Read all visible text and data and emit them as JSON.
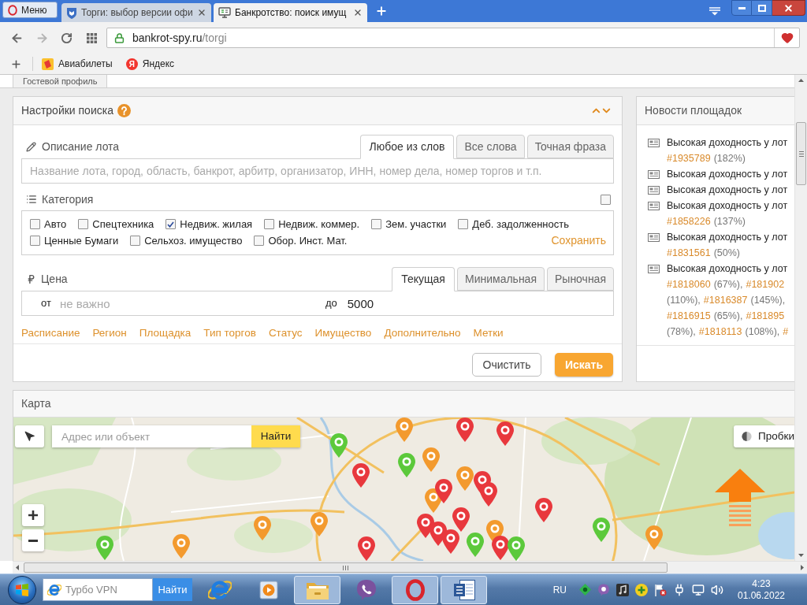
{
  "browser": {
    "menu_button": "Меню",
    "tabs": [
      {
        "title": "Торги: выбор версии офи",
        "selected": false,
        "kind": "emblem"
      },
      {
        "title": "Банкротство: поиск имущ",
        "selected": true,
        "kind": "monitor"
      }
    ],
    "address": {
      "host": "bankrot-spy.ru",
      "path": "/torgi"
    },
    "bookmarks": [
      {
        "kind": "tile",
        "label": "Авиабилеты"
      },
      {
        "kind": "letter",
        "logo": "Я",
        "label": "Яндекс"
      }
    ]
  },
  "profile_tab": {
    "label": "Гостевой профиль"
  },
  "search_panel": {
    "title": "Настройки поиска",
    "description": {
      "label": "Описание лота",
      "modes": [
        {
          "label": "Любое из слов",
          "selected": true
        },
        {
          "label": "Все слова",
          "selected": false
        },
        {
          "label": "Точная фраза",
          "selected": false
        }
      ],
      "placeholder": "Название лота, город, область, банкрот, арбитр, организатор, ИНН, номер дела, номер торгов и т.п."
    },
    "category": {
      "label": "Категория",
      "select_all": false,
      "options": [
        {
          "label": "Авто",
          "checked": false
        },
        {
          "label": "Спецтехника",
          "checked": false
        },
        {
          "label": "Недвиж. жилая",
          "checked": true
        },
        {
          "label": "Недвиж. коммер.",
          "checked": false
        },
        {
          "label": "Зем. участки",
          "checked": false
        },
        {
          "label": "Деб. задолженность",
          "checked": false
        },
        {
          "label": "Ценные Бумаги",
          "checked": false
        },
        {
          "label": "Сельхоз. имущество",
          "checked": false
        },
        {
          "label": "Обор. Инст. Мат.",
          "checked": false
        }
      ],
      "save_link": "Сохранить"
    },
    "price": {
      "label": "Цена",
      "modes": [
        {
          "label": "Текущая",
          "selected": true
        },
        {
          "label": "Минимальная",
          "selected": false
        },
        {
          "label": "Рыночная",
          "selected": false
        }
      ],
      "from_label": "от",
      "from_placeholder": "не важно",
      "to_label": "до",
      "to_value": "5000"
    },
    "filter_links": [
      "Расписание",
      "Регион",
      "Площадка",
      "Тип торгов",
      "Статус",
      "Имущество",
      "Дополнительно",
      "Метки"
    ],
    "clear_button": "Очистить",
    "search_button": "Искать"
  },
  "news_panel": {
    "title": "Новости площадок",
    "items": [
      {
        "title": "Высокая доходность у лот",
        "lines": [
          [
            {
              "kind": "lot",
              "text": "#1935789"
            },
            {
              "kind": "share",
              "text": "(182%)"
            }
          ]
        ]
      },
      {
        "title": "Высокая доходность у лот"
      },
      {
        "title": "Высокая доходность у лот"
      },
      {
        "title": "Высокая доходность у лот",
        "lines": [
          [
            {
              "kind": "lot",
              "text": "#1858226"
            },
            {
              "kind": "share",
              "text": "(137%)"
            }
          ]
        ]
      },
      {
        "title": "Высокая доходность у лот",
        "lines": [
          [
            {
              "kind": "lot",
              "text": "#1831561"
            },
            {
              "kind": "share",
              "text": "(50%)"
            }
          ]
        ]
      },
      {
        "title": "Высокая доходность у лот",
        "lines": [
          [
            {
              "kind": "lot",
              "text": "#1818060"
            },
            {
              "kind": "share",
              "text": "(67%),"
            },
            {
              "kind": "lot",
              "text": "#181902"
            }
          ],
          [
            {
              "kind": "share",
              "text": "(110%),"
            },
            {
              "kind": "lot",
              "text": "#1816387"
            },
            {
              "kind": "share",
              "text": "(145%),"
            }
          ],
          [
            {
              "kind": "lot",
              "text": "#1816915"
            },
            {
              "kind": "share",
              "text": "(65%),"
            },
            {
              "kind": "lot",
              "text": "#181895"
            }
          ],
          [
            {
              "kind": "share",
              "text": "(78%),"
            },
            {
              "kind": "lot",
              "text": "#1818113"
            },
            {
              "kind": "share",
              "text": "(108%),"
            },
            {
              "kind": "lot",
              "text": "#"
            }
          ]
        ]
      }
    ]
  },
  "map_panel": {
    "title": "Карта",
    "search_placeholder": "Адрес или объект",
    "search_button": "Найти",
    "traffic_button": "Пробки",
    "pins": [
      {
        "color": "#f39a2e"
      },
      {
        "color": "#e8383d"
      },
      {
        "color": "#e8383d"
      },
      {
        "color": "#5cc93b"
      },
      {
        "color": "#5cc93b"
      },
      {
        "color": "#f39a2e"
      },
      {
        "color": "#e8383d"
      },
      {
        "color": "#f39a2e"
      },
      {
        "color": "#e8383d"
      },
      {
        "color": "#e8383d"
      },
      {
        "color": "#f39a2e"
      },
      {
        "color": "#e8383d"
      },
      {
        "color": "#e8383d"
      },
      {
        "color": "#e8383d"
      },
      {
        "color": "#f39a2e"
      },
      {
        "color": "#e8383d"
      },
      {
        "color": "#e8383d"
      },
      {
        "color": "#e8383d"
      },
      {
        "color": "#5cc93b"
      },
      {
        "color": "#e8383d"
      },
      {
        "color": "#e8383d"
      },
      {
        "color": "#f39a2e"
      },
      {
        "color": "#f39a2e"
      },
      {
        "color": "#f39a2e"
      },
      {
        "color": "#5cc93b"
      },
      {
        "color": "#5cc93b"
      },
      {
        "color": "#f39a2e"
      },
      {
        "color": "#5cc93b"
      }
    ]
  },
  "taskbar": {
    "search_placeholder": "Турбо VPN",
    "search_button": "Найти",
    "apps": [
      {
        "kind": "e_logo",
        "open": false
      },
      {
        "kind": "player",
        "open": false
      },
      {
        "kind": "folder",
        "open": true
      },
      {
        "kind": "phone",
        "open": false
      },
      {
        "kind": "ring",
        "open": true
      },
      {
        "kind": "document",
        "open": true
      }
    ],
    "language": "RU",
    "time": "4:23",
    "date": "01.06.2022"
  }
}
